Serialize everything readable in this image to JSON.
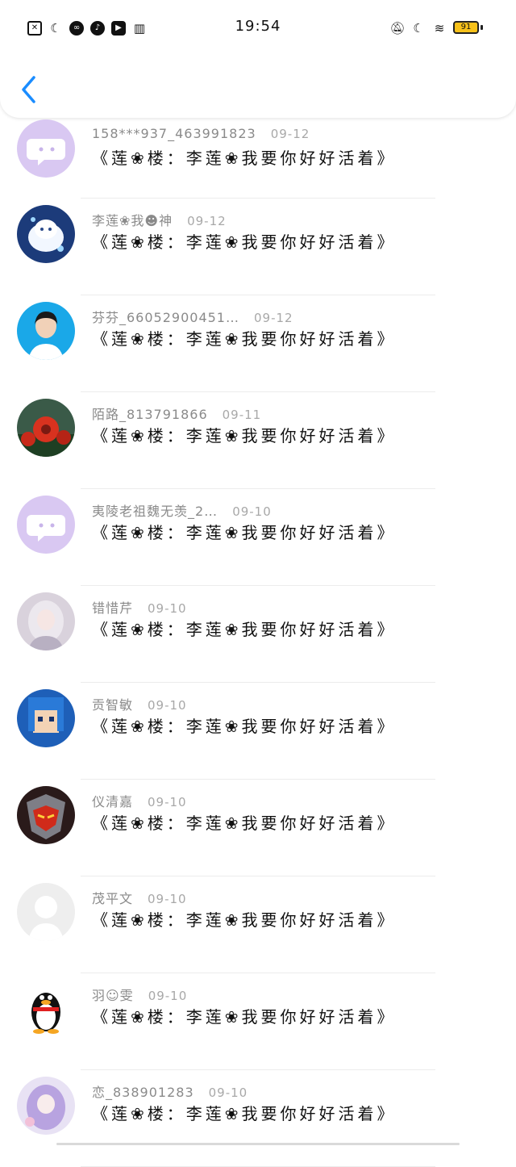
{
  "status": {
    "time": "19:54",
    "battery": "91",
    "left_icons": [
      "sim-off-icon",
      "moon-icon",
      "link-icon",
      "music-icon",
      "play-icon",
      "book-icon"
    ],
    "right_icons": [
      "mute-icon",
      "moon-icon",
      "wifi-icon"
    ]
  },
  "header": {
    "back_icon": "chevron-left-icon"
  },
  "comments": [
    {
      "user": "158***937_463991823",
      "date": "09-12",
      "text": "《莲❀楼：李莲❀我要你好好活着》",
      "avatar": "placeholder-chat-bubble"
    },
    {
      "user": "李莲❀我☻神",
      "date": "09-12",
      "text": "《莲❀楼：李莲❀我要你好好活着》",
      "avatar": "white-cat"
    },
    {
      "user": "芬芬_66052900451…",
      "date": "09-12",
      "text": "《莲❀楼：李莲❀我要你好好活着》",
      "avatar": "portrait-blue"
    },
    {
      "user": "陌路_813791866",
      "date": "09-11",
      "text": "《莲❀楼：李莲❀我要你好好活着》",
      "avatar": "red-flowers"
    },
    {
      "user": "夷陵老祖魏无羡_2…",
      "date": "09-10",
      "text": "《莲❀楼：李莲❀我要你好好活着》",
      "avatar": "placeholder-chat-bubble"
    },
    {
      "user": "错惜芹",
      "date": "09-10",
      "text": "《莲❀楼：李莲❀我要你好好活着》",
      "avatar": "anime-girl"
    },
    {
      "user": "贡智敏",
      "date": "09-10",
      "text": "《莲❀楼：李莲❀我要你好好活着》",
      "avatar": "pixel-character"
    },
    {
      "user": "仪清嘉",
      "date": "09-10",
      "text": "《莲❀楼：李莲❀我要你好好活着》",
      "avatar": "red-mask"
    },
    {
      "user": "茂平文",
      "date": "09-10",
      "text": "《莲❀楼：李莲❀我要你好好活着》",
      "avatar": "default-person"
    },
    {
      "user": "羽☺雯",
      "date": "09-10",
      "text": "《莲❀楼：李莲❀我要你好好活着》",
      "avatar": "qq-penguin"
    },
    {
      "user": "恋_838901283",
      "date": "09-10",
      "text": "《莲❀楼：李莲❀我要你好好活着》",
      "avatar": "purple-anime"
    }
  ]
}
